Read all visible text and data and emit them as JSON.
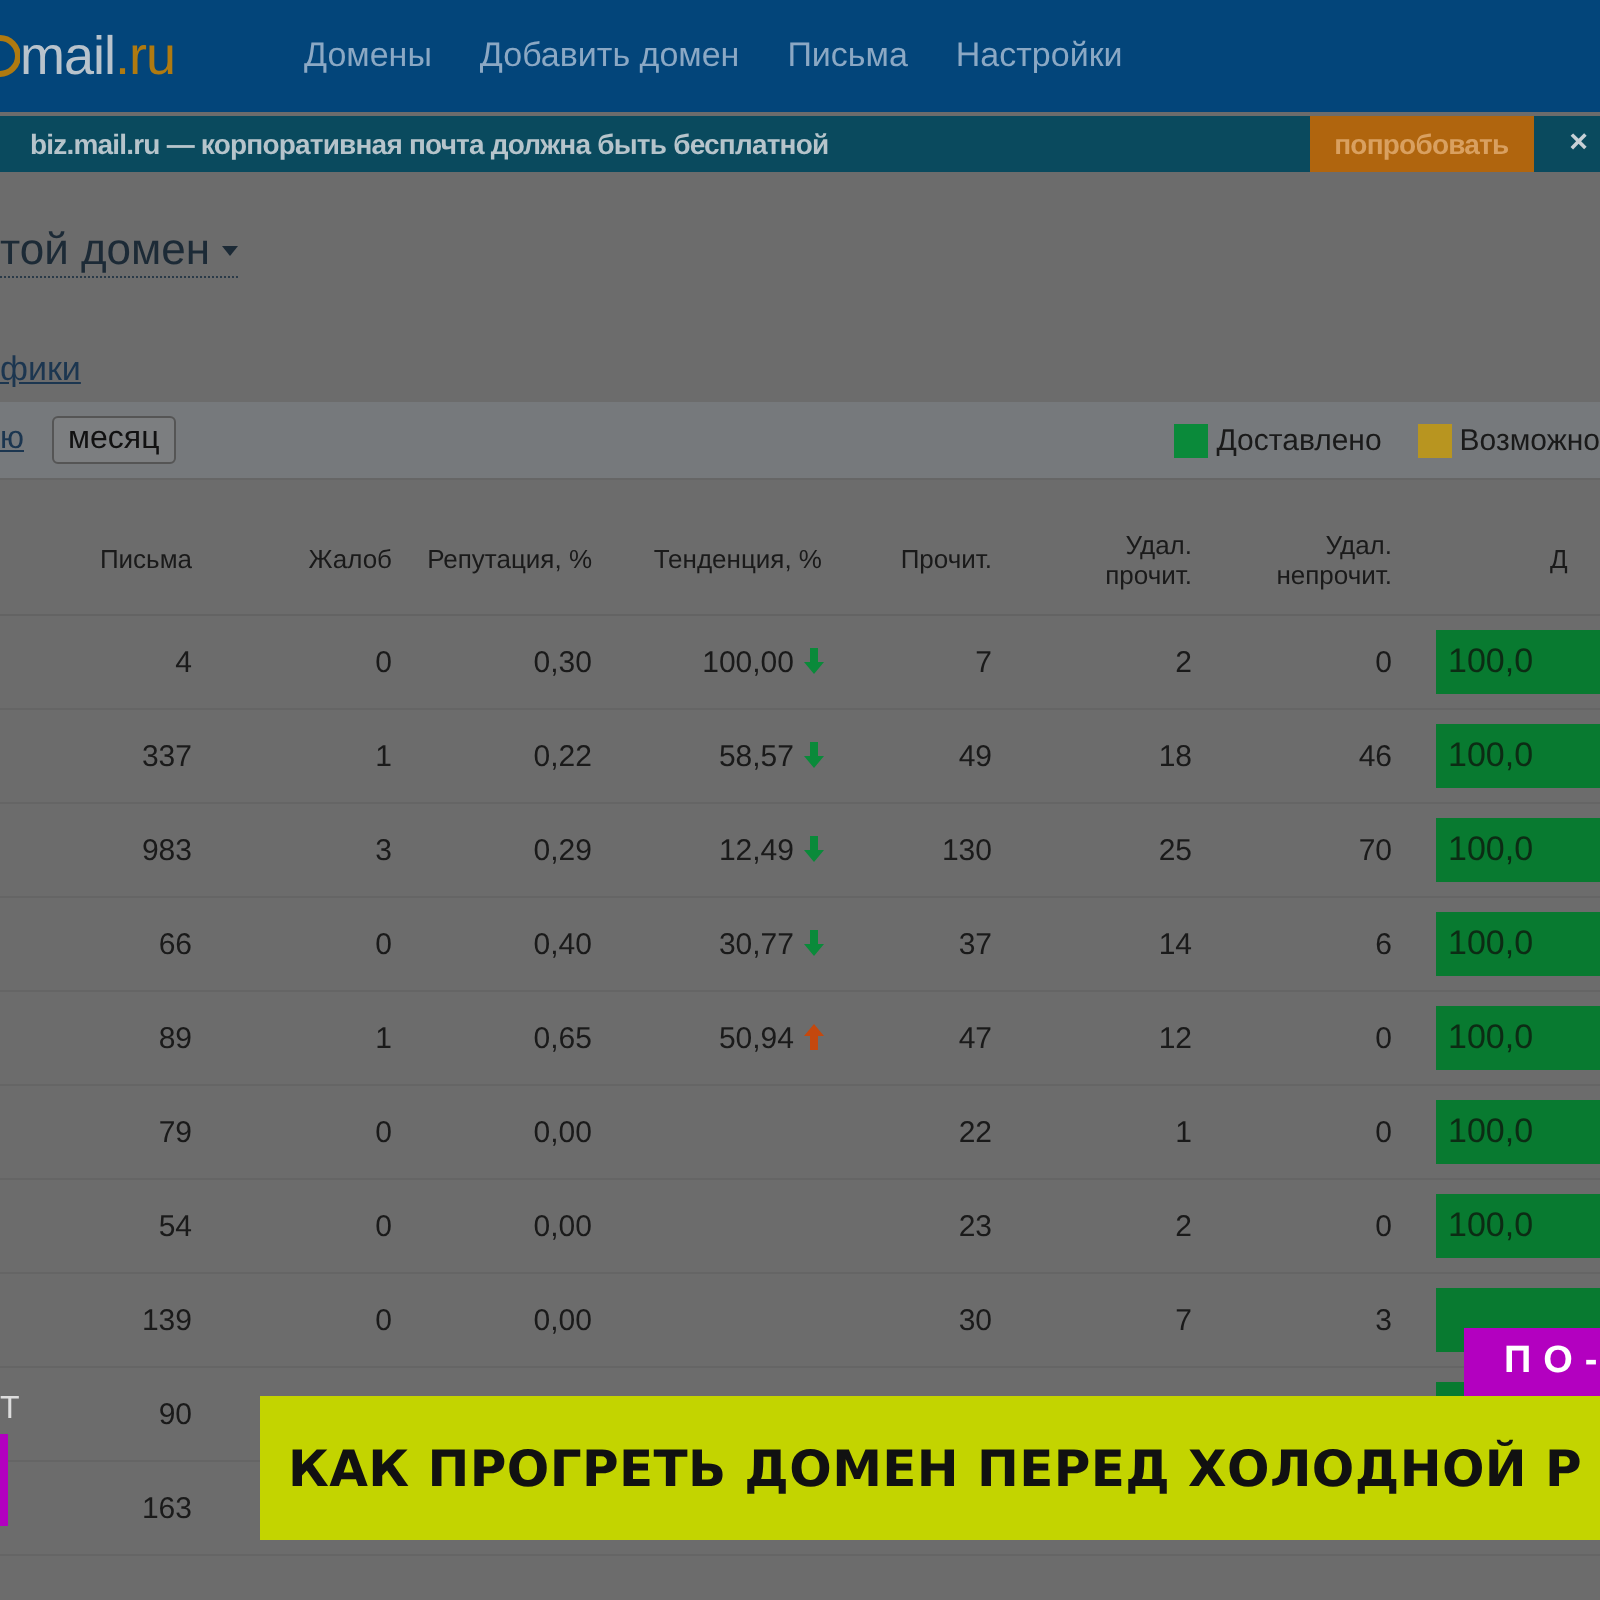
{
  "header": {
    "logo": {
      "name": "mail",
      "suffix": ".ru"
    },
    "nav": [
      {
        "label": "Домены"
      },
      {
        "label": "Добавить домен"
      },
      {
        "label": "Письма"
      },
      {
        "label": "Настройки"
      }
    ]
  },
  "promo": {
    "text": "biz.mail.ru — корпоративная почта должна быть бесплатной",
    "button": "попробовать",
    "close": "×"
  },
  "domain_selector": {
    "label": "той домен"
  },
  "section_link": "фики",
  "toolbar": {
    "period_link": "ю",
    "period_button": "месяц",
    "legend": [
      {
        "label": "Доставлено",
        "color": "#0a8a3a"
      },
      {
        "label": "Возможно",
        "color": "#b89520"
      }
    ]
  },
  "table": {
    "columns": [
      "Письма",
      "Жалоб",
      "Репутация, %",
      "Тенденция, %",
      "Прочит.",
      "Удал. прочит.",
      "Удал. непрочит.",
      "Д"
    ],
    "rows": [
      {
        "cells": [
          "4",
          "0",
          "0,30",
          "100,00",
          "7",
          "2",
          "0"
        ],
        "rising": false,
        "delivered": "100,0"
      },
      {
        "cells": [
          "337",
          "1",
          "0,22",
          "58,57",
          "49",
          "18",
          "46"
        ],
        "rising": false,
        "delivered": "100,0"
      },
      {
        "cells": [
          "983",
          "3",
          "0,29",
          "12,49",
          "130",
          "25",
          "70"
        ],
        "rising": false,
        "delivered": "100,0"
      },
      {
        "cells": [
          "66",
          "0",
          "0,40",
          "30,77",
          "37",
          "14",
          "6"
        ],
        "rising": false,
        "delivered": "100,0"
      },
      {
        "cells": [
          "89",
          "1",
          "0,65",
          "50,94",
          "47",
          "12",
          "0"
        ],
        "rising": true,
        "delivered": "100,0"
      },
      {
        "cells": [
          "79",
          "0",
          "0,00",
          "",
          "22",
          "1",
          "0"
        ],
        "delivered": "100,0"
      },
      {
        "cells": [
          "54",
          "0",
          "0,00",
          "",
          "23",
          "2",
          "0"
        ],
        "delivered": "100,0"
      },
      {
        "cells": [
          "139",
          "0",
          "0,00",
          "",
          "30",
          "7",
          "3"
        ]
      },
      {
        "cells": [
          "90",
          "",
          "",
          "",
          "",
          "",
          ""
        ]
      },
      {
        "cells": [
          "163",
          "",
          "",
          "",
          "",
          "",
          ""
        ]
      }
    ]
  },
  "overlay": {
    "side_label": "Т",
    "badge": "ПО-",
    "headline": "КАК ПРОГРЕТЬ ДОМЕН ПЕРЕД ХОЛОДНОЙ Р"
  }
}
